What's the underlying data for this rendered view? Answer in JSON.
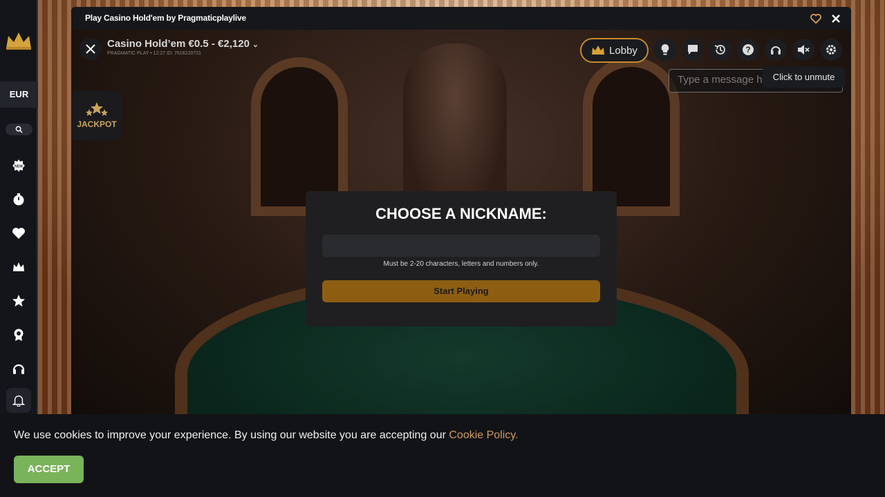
{
  "window": {
    "title": "Play Casino Hold'em by Pragmaticplaylive"
  },
  "sidebar": {
    "currency": "EUR",
    "icons": [
      "new-icon",
      "timer-icon",
      "heart-icon",
      "crown-icon",
      "star-icon",
      "award-icon",
      "headset-icon",
      "bell-icon"
    ]
  },
  "game": {
    "title": "Casino Hold’em €0.5 - €2,120",
    "subtitle": "PRAGMATIC PLAY • 12:27  ID: 7618220721",
    "lobby_label": "Lobby",
    "message_placeholder": "Type a message h",
    "tooltip": "Click to unmute",
    "jackpot_label": "JACKPOT"
  },
  "modal": {
    "title": "CHOOSE A NICKNAME:",
    "input_value": "",
    "hint": "Must be 2-20 characters, letters and numbers only.",
    "start_label": "Start Playing"
  },
  "cookie": {
    "text": "We use cookies to improve your experience. By using our website you are accepting our ",
    "link": "Cookie Policy.",
    "accept_label": "ACCEPT"
  },
  "colors": {
    "accent_gold": "#c78a2c",
    "start_button": "#8d5e12",
    "accept_button": "#79b35a",
    "cookie_link": "#d19a58"
  }
}
